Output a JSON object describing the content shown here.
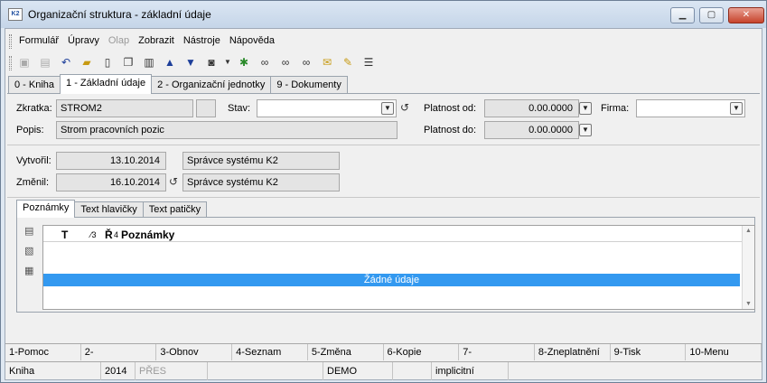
{
  "window": {
    "title": "Organizační struktura - základní údaje",
    "app_icon_text": "K2"
  },
  "menu": [
    "Formulář",
    "Úpravy",
    "Olap",
    "Zobrazit",
    "Nástroje",
    "Nápověda"
  ],
  "menu_disabled": [
    false,
    false,
    true,
    false,
    false,
    false
  ],
  "main_tabs": [
    "0 - Kniha",
    "1 - Základní údaje",
    "2 - Organizační jednotky",
    "9 - Dokumenty"
  ],
  "form": {
    "zkratka_label": "Zkratka:",
    "zkratka_value": "STROM2",
    "stav_label": "Stav:",
    "stav_value": "",
    "platnost_od_label": "Platnost od:",
    "platnost_od_value": "0.00.0000",
    "firma_label": "Firma:",
    "firma_value": "",
    "popis_label": "Popis:",
    "popis_value": "Strom pracovních pozic",
    "platnost_do_label": "Platnost do:",
    "platnost_do_value": "0.00.0000",
    "vytvoril_label": "Vytvořil:",
    "vytvoril_date": "13.10.2014",
    "vytvoril_user": "Správce systému K2",
    "zmenil_label": "Změnil:",
    "zmenil_date": "16.10.2014",
    "zmenil_user": "Správce systému K2"
  },
  "sub_tabs": [
    "Poznámky",
    "Text hlavičky",
    "Text patičky"
  ],
  "notes_grid": {
    "col_t": "T",
    "col_small1": "⁄3",
    "col_r": "Ř",
    "col_small2": "4",
    "col_notes": "Poznámky",
    "empty_text": "Žádné údaje"
  },
  "fkeys": [
    "1-Pomoc",
    "2-",
    "3-Obnov",
    "4-Seznam",
    "5-Změna",
    "6-Kopie",
    "7-",
    "8-Zneplatnění",
    "9-Tisk",
    "10-Menu"
  ],
  "status": {
    "book": "Kniha",
    "year": "2014",
    "mode": "PŘES",
    "company": "DEMO",
    "currency": "implicitní"
  },
  "icons": {
    "toolbar": [
      "save-icon",
      "save-close-icon",
      "undo-icon",
      "open-folder-icon",
      "new-document-icon",
      "copy-icon",
      "book-icon",
      "arrow-up-icon",
      "arrow-down-icon",
      "camera-icon",
      "dropdown-icon",
      "filter-icon",
      "binoculars-icon",
      "binoculars-next-icon",
      "binoculars-all-icon",
      "mail-icon",
      "edit-folder-icon",
      "menu-lines-icon"
    ]
  },
  "colors": {
    "selection": "#3399f0",
    "close_button": "#c7432b"
  }
}
